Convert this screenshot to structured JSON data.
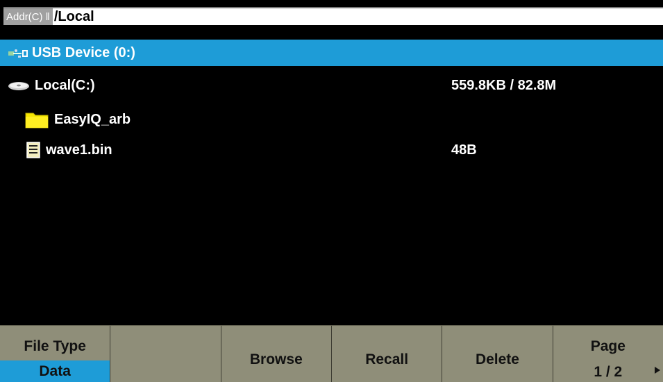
{
  "address": {
    "label": "Addr(C) ‖",
    "path": "/Local"
  },
  "files": [
    {
      "name": "USB Device (0:)",
      "size": "",
      "icon": "usb-icon",
      "selected": true
    },
    {
      "name": "Local(C:)",
      "size": "559.8KB / 82.8M",
      "icon": "disk-icon",
      "selected": false
    },
    {
      "name": "EasyIQ_arb",
      "size": "",
      "icon": "folder-icon",
      "selected": false
    },
    {
      "name": "wave1.bin",
      "size": "48B",
      "icon": "file-icon",
      "selected": false
    }
  ],
  "softkeys": {
    "file_type": {
      "label": "File Type",
      "value": "Data"
    },
    "blank": "",
    "browse": "Browse",
    "recall": "Recall",
    "delete": "Delete",
    "page": {
      "label": "Page",
      "value": "1 / 2"
    }
  },
  "colors": {
    "selection": "#1e9cd7",
    "softkey_bg": "#8f8e79",
    "folder": "#f5e600"
  }
}
